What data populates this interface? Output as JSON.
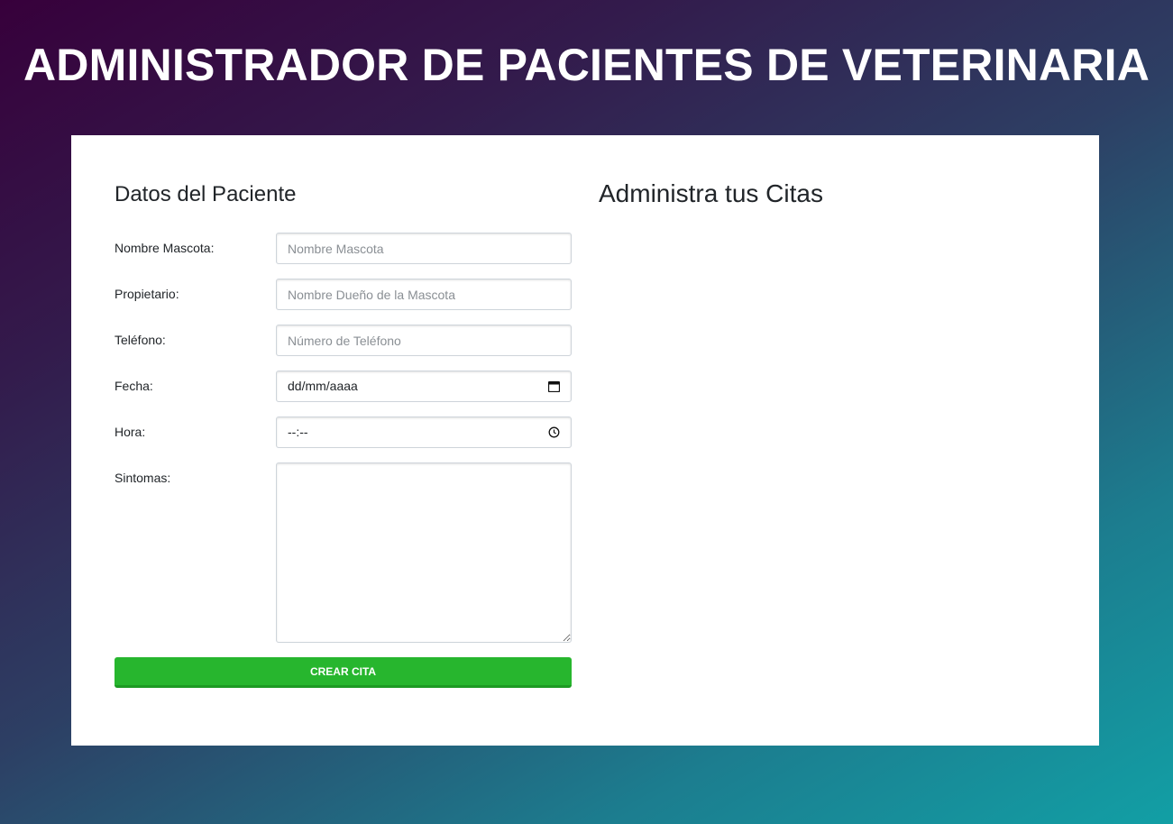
{
  "header": {
    "title": "ADMINISTRADOR DE PACIENTES DE VETERINARIA"
  },
  "form": {
    "title": "Datos del Paciente",
    "fields": [
      {
        "label": "Nombre Mascota:",
        "placeholder": "Nombre Mascota"
      },
      {
        "label": "Propietario:",
        "placeholder": "Nombre Dueño de la Mascota"
      },
      {
        "label": "Teléfono:",
        "placeholder": "Número de Teléfono"
      },
      {
        "label": "Fecha:",
        "value": "dd/mm/aaaa",
        "icon": "calendar-icon"
      },
      {
        "label": "Hora:",
        "value": "--:--",
        "icon": "clock-icon"
      },
      {
        "label": "Sintomas:"
      }
    ],
    "submit_label": "CREAR CITA"
  },
  "appointments": {
    "title": "Administra tus Citas"
  },
  "colors": {
    "button_green": "#27b62e",
    "gradient_start": "#37003b",
    "gradient_end": "#129fa5"
  }
}
